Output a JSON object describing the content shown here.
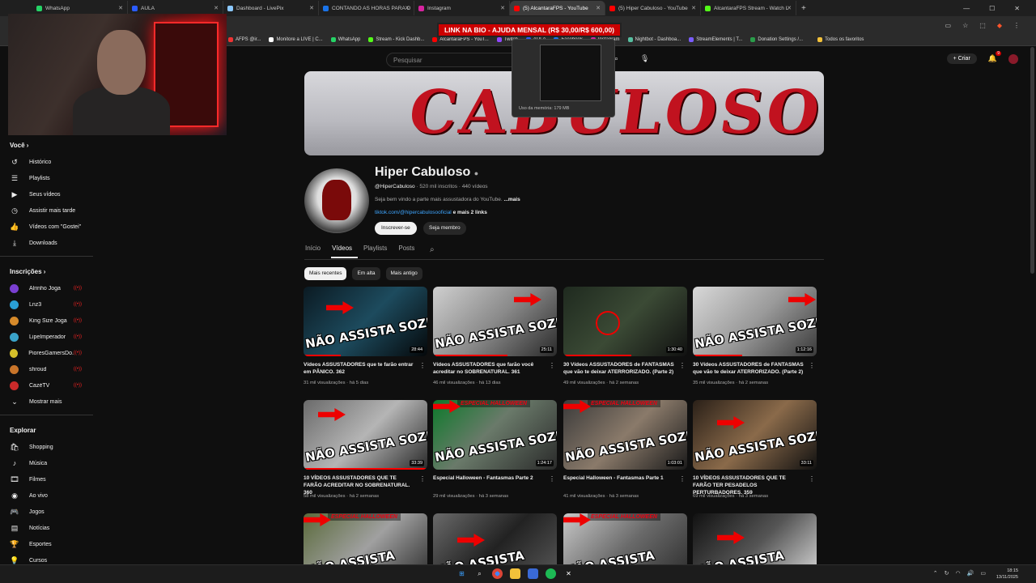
{
  "tabs": [
    {
      "label": "WhatsApp",
      "color": "#25d366"
    },
    {
      "label": "AULA",
      "color": "#2b5cff"
    },
    {
      "label": "Dashboard - LivePix",
      "color": "#8bc8ff"
    },
    {
      "label": "CONTANDO AS HORAS PARA O",
      "color": "#1a73e8"
    },
    {
      "label": "Instagram",
      "color": "#d6249f"
    },
    {
      "label": "(5) AlcantaraFPS - YouTube",
      "color": "#ff0000"
    },
    {
      "label": "(5) Hiper Cabuloso - YouTube",
      "color": "#ff0000"
    },
    {
      "label": "AlcantaraFPS Stream - Watch L",
      "color": "#53fc18"
    }
  ],
  "bookmarks": [
    "AFPS @ir...",
    "Monitore a LIVE | C...",
    "WhatsApp",
    "Stream - Kick Dashb...",
    "AlcantaraFPS - YouT...",
    "Twitch",
    "AULA",
    "Facebook",
    "Instagram",
    "Nightbot - Dashboa...",
    "StreamElements | T...",
    "Donation Settings /...",
    "Todos os favoritos"
  ],
  "overlay_banner": "LINK NA BIO - AJUDA MENSAL (R$ 30,00/R$ 600,00)",
  "tab_preview": {
    "memory": "Uso da memória: 179 MB"
  },
  "search_placeholder": "Pesquisar",
  "create_label": "Criar",
  "notif_count": "9",
  "sidebar": {
    "you_title": "Você",
    "you_items": [
      {
        "label": "Histórico",
        "icon": "history-icon",
        "glyph": "↺"
      },
      {
        "label": "Playlists",
        "icon": "playlist-icon",
        "glyph": "☰"
      },
      {
        "label": "Seus vídeos",
        "icon": "video-icon",
        "glyph": "▶"
      },
      {
        "label": "Assistir mais tarde",
        "icon": "clock-icon",
        "glyph": "◷"
      },
      {
        "label": "Vídeos com \"Gostei\"",
        "icon": "like-icon",
        "glyph": "👍"
      },
      {
        "label": "Downloads",
        "icon": "download-icon",
        "glyph": "⤓"
      }
    ],
    "subs_title": "Inscrições",
    "subs": [
      {
        "label": "Alrinho Joga",
        "color": "#7a3fd1"
      },
      {
        "label": "Lnz3",
        "color": "#2a9fd6"
      },
      {
        "label": "King Size Joga",
        "color": "#d68a2a"
      },
      {
        "label": "LipeImperador",
        "color": "#3aa3c9"
      },
      {
        "label": "PioresGamersDo...",
        "color": "#d6c02a"
      },
      {
        "label": "shroud",
        "color": "#c9752a"
      },
      {
        "label": "CazéTV",
        "color": "#c92a2a"
      }
    ],
    "show_more": "Mostrar mais",
    "explore_title": "Explorar",
    "explore": [
      {
        "label": "Shopping",
        "icon": "shopping-icon",
        "glyph": "🛍"
      },
      {
        "label": "Música",
        "icon": "music-icon",
        "glyph": "♪"
      },
      {
        "label": "Filmes",
        "icon": "film-icon",
        "glyph": "🎞"
      },
      {
        "label": "Ao vivo",
        "icon": "live-icon",
        "glyph": "◉"
      },
      {
        "label": "Jogos",
        "icon": "game-icon",
        "glyph": "🎮"
      },
      {
        "label": "Notícias",
        "icon": "news-icon",
        "glyph": "▤"
      },
      {
        "label": "Esportes",
        "icon": "trophy-icon",
        "glyph": "🏆"
      },
      {
        "label": "Cursos",
        "icon": "bulb-icon",
        "glyph": "💡"
      }
    ]
  },
  "channel": {
    "banner_text": "CABULOSO",
    "name": "Hiper Cabuloso",
    "handle": "@HiperCabuloso",
    "stats": " · 520 mil inscritos · 440 vídeos",
    "description": "Seja bem vindo a parte mais assustadora do YouTube.",
    "more": " ...mais",
    "link": "tiktok.com/@hipercabulosooficial",
    "more_links": " e mais 2 links",
    "subscribe": "Inscrever-se",
    "member": "Seja membro"
  },
  "channel_tabs": [
    "Início",
    "Vídeos",
    "Playlists",
    "Posts"
  ],
  "chips": [
    "Mais recentes",
    "Em alta",
    "Mais antigo"
  ],
  "videos": [
    {
      "title": "Vídeos ASSUSTADORES que te farão entrar em PÂNICO. 362",
      "views": "31 mil visualizações",
      "age": "há 5 dias",
      "duration": "28:44",
      "thumb_text": "NÃO ASSISTA SOZINHO",
      "bg": "linear-gradient(135deg,#0b1a22,#1d4b5e 50%,#05080a)",
      "progress": 0.3
    },
    {
      "title": "Vídeos ASSUSTADORES que farão você acreditar no SOBRENATURAL. 361",
      "views": "46 mil visualizações",
      "age": "há 13 dias",
      "duration": "25:11",
      "thumb_text": "NÃO ASSISTA SOZINHO",
      "bg": "linear-gradient(135deg,#cfcfcf,#8a8a8a 50%,#2a2a2a)",
      "progress": 0.6
    },
    {
      "title": "30 Vídeos ASSUSTADORES de FANTASMAS que vão te deixar ATERRORIZADO. (Parte 2)",
      "views": "49 mil visualizações",
      "age": "há 2 semanas",
      "duration": "1:30:40",
      "thumb_text": "",
      "bg": "linear-gradient(135deg,#1f2a1f,#3b4a35 50%,#111)",
      "progress": 0.55
    },
    {
      "title": "30 Vídeos ASSUSTADORES de FANTASMAS que vão te deixar ATERRORIZADO. (Parte 2)",
      "views": "35 mil visualizações",
      "age": "há 2 semanas",
      "duration": "1:12:16",
      "thumb_text": "NÃO ASSISTA SOZINHO",
      "bg": "linear-gradient(135deg,#d8d8d8,#9a9a9a 50%,#3a3a3a)",
      "progress": 0.4
    },
    {
      "title": "10 VÍDEOS ASSUSTADORES QUE TE FARÃO ACREDITAR NO SOBRENATURAL. 360",
      "views": "58 mil visualizações",
      "age": "há 2 semanas",
      "duration": "33:39",
      "thumb_text": "NÃO ASSISTA SOZINHO",
      "bg": "linear-gradient(135deg,#6a6a6a,#b5b5b5 50%,#2a2a2a)",
      "progress": 1.0
    },
    {
      "title": "Especial Halloween - Fantasmas Parte 2",
      "views": "29 mil visualizações",
      "age": "há 3 semanas",
      "duration": "1:24:17",
      "thumb_text": "NÃO ASSISTA SOZINHO",
      "bg": "linear-gradient(135deg,#0c7a2a,#6a7a6a 45%,#2a2a2a)",
      "progress": 0,
      "halloween": "ESPECIAL HALLOWEEN"
    },
    {
      "title": "Especial Halloween - Fantasmas Parte 1",
      "views": "41 mil visualizações",
      "age": "há 3 semanas",
      "duration": "1:03:01",
      "thumb_text": "NÃO ASSISTA SOZINHO",
      "bg": "linear-gradient(135deg,#3a3a3a,#8a7a6a 50%,#1a1a1a)",
      "progress": 0,
      "halloween": "ESPECIAL HALLOWEEN"
    },
    {
      "title": "10 VÍDEOS ASSUSTADORES QUE TE FARÃO TER PESADELOS PERTURBADORES. 359",
      "views": "69 mil visualizações",
      "age": "há 3 semanas",
      "duration": "33:11",
      "thumb_text": "NÃO ASSISTA SOZINHO",
      "bg": "linear-gradient(135deg,#2a2018,#8a6a4a 50%,#111)",
      "progress": 0
    },
    {
      "title": "",
      "views": "",
      "age": "",
      "duration": "",
      "thumb_text": "NÃO ASSISTA",
      "bg": "linear-gradient(135deg,#5a6a3a,#a0a0a0 50%,#2a2a2a)",
      "progress": 0,
      "halloween": "ESPECIAL HALLOWEEN"
    },
    {
      "title": "",
      "views": "",
      "age": "",
      "duration": "",
      "thumb_text": "NÃO ASSISTA",
      "bg": "linear-gradient(135deg,#6a6a6a,#222 50%,#5a5a5a)",
      "progress": 0
    },
    {
      "title": "",
      "views": "",
      "age": "",
      "duration": "",
      "thumb_text": "NÃO ASSISTA",
      "bg": "linear-gradient(135deg,#c8c8c8,#6a6a6a 50%,#2a2a2a)",
      "progress": 0,
      "halloween": "ESPECIAL HALLOWEEN"
    },
    {
      "title": "",
      "views": "",
      "age": "",
      "duration": "",
      "thumb_text": "NÃO ASSISTA",
      "bg": "linear-gradient(135deg,#111,#555 50%,#ddd)",
      "progress": 0
    }
  ],
  "clock": {
    "time": "18:15",
    "date": "13/11/2025"
  }
}
